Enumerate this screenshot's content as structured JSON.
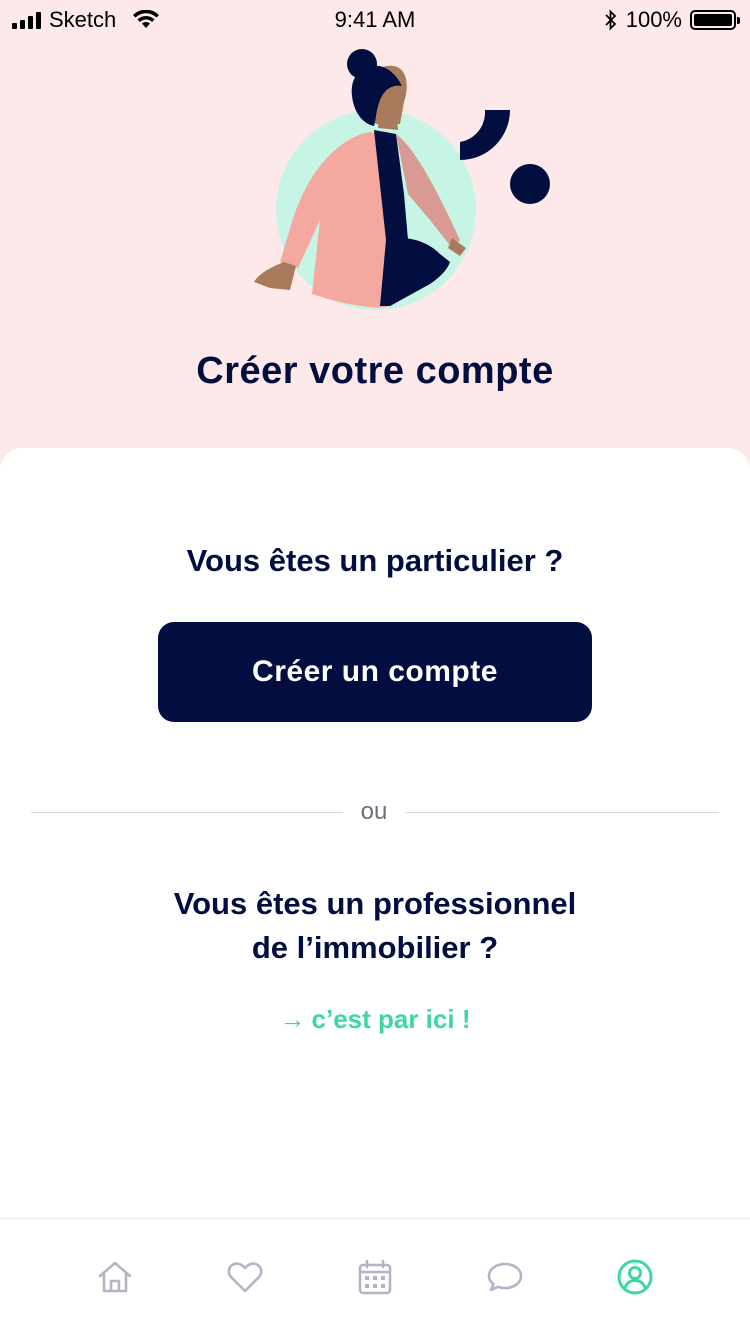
{
  "status_bar": {
    "carrier": "Sketch",
    "time": "9:41 AM",
    "battery": "100%",
    "battery_level": 1.0,
    "icons": [
      "signal-icon",
      "wifi-icon",
      "bluetooth-icon",
      "battery-icon"
    ]
  },
  "header": {
    "title": "Créer votre compte"
  },
  "card": {
    "individual_question": "Vous êtes un particulier ?",
    "create_button_label": "Créer un compte",
    "divider_label": "ou",
    "pro_question_line1": "Vous êtes un professionnel",
    "pro_question_line2": "de l’immobilier ?",
    "pro_link_arrow": "→",
    "pro_link_label": "c’est par ici !"
  },
  "tab_bar": {
    "tabs": [
      {
        "icon": "home-icon",
        "active": false
      },
      {
        "icon": "heart-icon",
        "active": false
      },
      {
        "icon": "calendar-icon",
        "active": false
      },
      {
        "icon": "chat-icon",
        "active": false
      },
      {
        "icon": "profile-icon",
        "active": true
      }
    ]
  },
  "colors": {
    "background_pink": "#fde9e9",
    "navy": "#020e3f",
    "accent_green": "#3fd6a6",
    "mint": "#c6f5e6",
    "coral": "#f5a8a0",
    "tab_inactive": "#b3b5c4"
  }
}
